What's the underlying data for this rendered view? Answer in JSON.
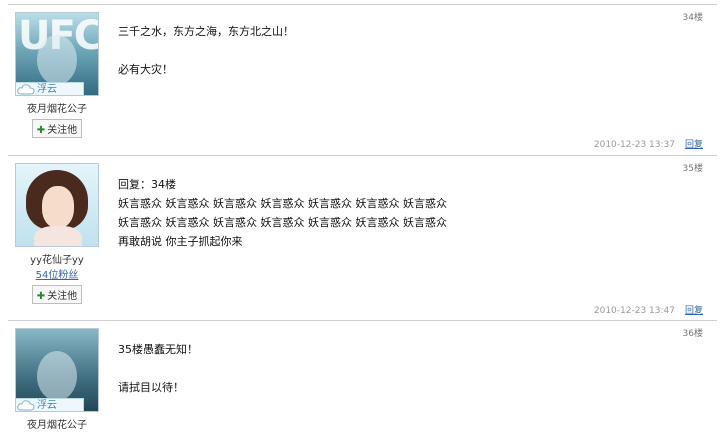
{
  "posts": [
    {
      "floor": "34楼",
      "username": "夜月烟花公子",
      "badge": "浮云",
      "follow_label": "关注他",
      "lines": [
        "三千之水，东方之海，东方北之山！",
        "",
        "必有大灾！"
      ],
      "date": "2010-12-23 13:37",
      "reply_label": "回复",
      "avatar_text": "UFC"
    },
    {
      "floor": "35楼",
      "username": "yy花仙子yy",
      "fans": "54位粉丝",
      "follow_label": "关注他",
      "lines": [
        "回复：34楼",
        "妖言惑众 妖言惑众 妖言惑众 妖言惑众 妖言惑众 妖言惑众 妖言惑众",
        "妖言惑众 妖言惑众 妖言惑众 妖言惑众 妖言惑众 妖言惑众 妖言惑众",
        "再敢胡说 你主子抓起你来"
      ],
      "date": "2010-12-23 13:47",
      "reply_label": "回复"
    },
    {
      "floor": "36楼",
      "username": "夜月烟花公子",
      "badge": "浮云",
      "lines": [
        "35楼愚蠢无知！",
        "",
        "请拭目以待！"
      ]
    }
  ]
}
